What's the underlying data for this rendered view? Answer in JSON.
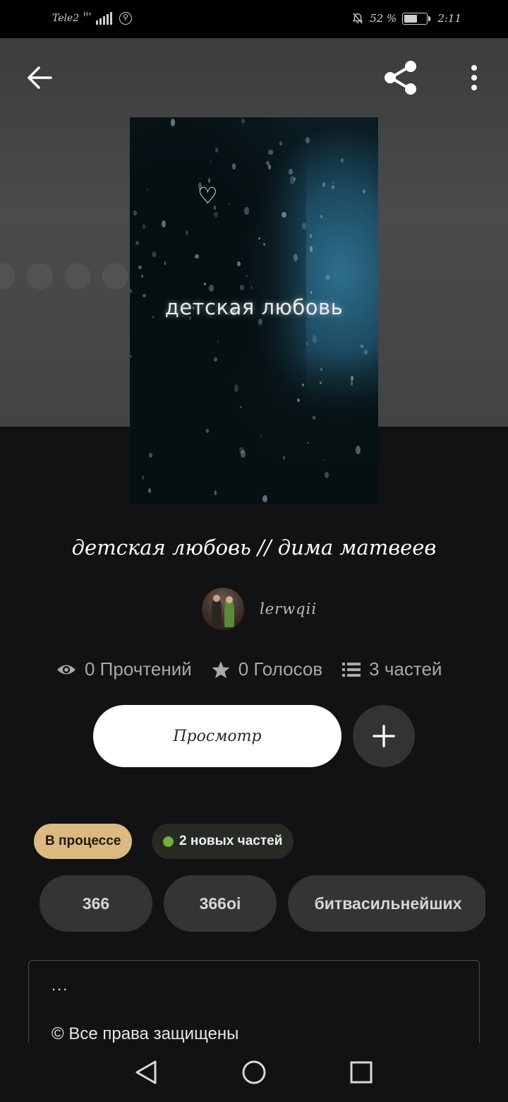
{
  "status_bar": {
    "carrier": "Tele2",
    "network_type": "H+",
    "battery_percent": "52 %",
    "time": "2:11"
  },
  "header": {
    "back_icon": "arrow-left-icon",
    "share_icon": "share-icon",
    "more_icon": "more-vertical-icon"
  },
  "cover": {
    "heart": "♡",
    "title": "детская любовь"
  },
  "story": {
    "title": "детская любовь // дима матвеев",
    "author": "lerwqii"
  },
  "stats": {
    "reads": "0 Прочтений",
    "votes": "0 Голосов",
    "parts": "3 частей"
  },
  "actions": {
    "read_label": "Просмотр",
    "add_label": "+"
  },
  "badges": {
    "status": "В процессе",
    "new_parts": "2 новых частей"
  },
  "tags": [
    "366",
    "366oi",
    "битвасильнейших"
  ],
  "description": {
    "ellipsis": "...",
    "copyright": "© Все права защищены"
  },
  "colors": {
    "background": "#121113",
    "status_badge": "#dbb97f",
    "new_dot": "#6fae3f"
  }
}
